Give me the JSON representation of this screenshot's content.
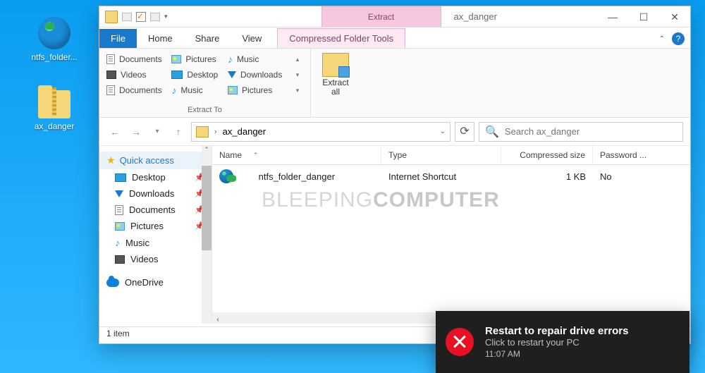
{
  "desktop": {
    "icons": [
      {
        "label": "ntfs_folder...",
        "kind": "globe"
      },
      {
        "label": "ax_danger",
        "kind": "zip"
      }
    ]
  },
  "window": {
    "title": "ax_danger",
    "context_tab_title": "Extract",
    "context_tab_sub": "Compressed Folder Tools",
    "tabs": {
      "file": "File",
      "home": "Home",
      "share": "Share",
      "view": "View"
    },
    "win_btns": {
      "min": "—",
      "max": "☐",
      "close": "✕"
    },
    "ribbon": {
      "destinations": [
        "Documents",
        "Pictures",
        "Music",
        "Videos",
        "Desktop",
        "Downloads",
        "Documents",
        "Music",
        "Pictures"
      ],
      "group_label": "Extract To",
      "extract_all": "Extract\nall",
      "help": "?"
    },
    "nav": {
      "back": "←",
      "fwd": "→",
      "up": "↑",
      "path": "ax_danger",
      "path_sep": "›",
      "refresh": "⟳",
      "search_placeholder": "Search ax_danger",
      "search_icon": "🔍"
    },
    "sidebar": {
      "quick_access": "Quick access",
      "items": [
        {
          "label": "Desktop",
          "icon": "monitor"
        },
        {
          "label": "Downloads",
          "icon": "dl"
        },
        {
          "label": "Documents",
          "icon": "doc"
        },
        {
          "label": "Pictures",
          "icon": "pic"
        },
        {
          "label": "Music",
          "icon": "mus"
        },
        {
          "label": "Videos",
          "icon": "vid"
        }
      ],
      "onedrive": "OneDrive"
    },
    "columns": {
      "name": "Name",
      "type": "Type",
      "size": "Compressed size",
      "pwd": "Password ..."
    },
    "rows": [
      {
        "name": "ntfs_folder_danger",
        "type": "Internet Shortcut",
        "size": "1 KB",
        "pwd": "No"
      }
    ],
    "watermark_a": "BLEEPING",
    "watermark_b": "COMPUTER",
    "status": "1 item"
  },
  "toast": {
    "title": "Restart to repair drive errors",
    "subtitle": "Click to restart your PC",
    "time": "11:07 AM"
  }
}
